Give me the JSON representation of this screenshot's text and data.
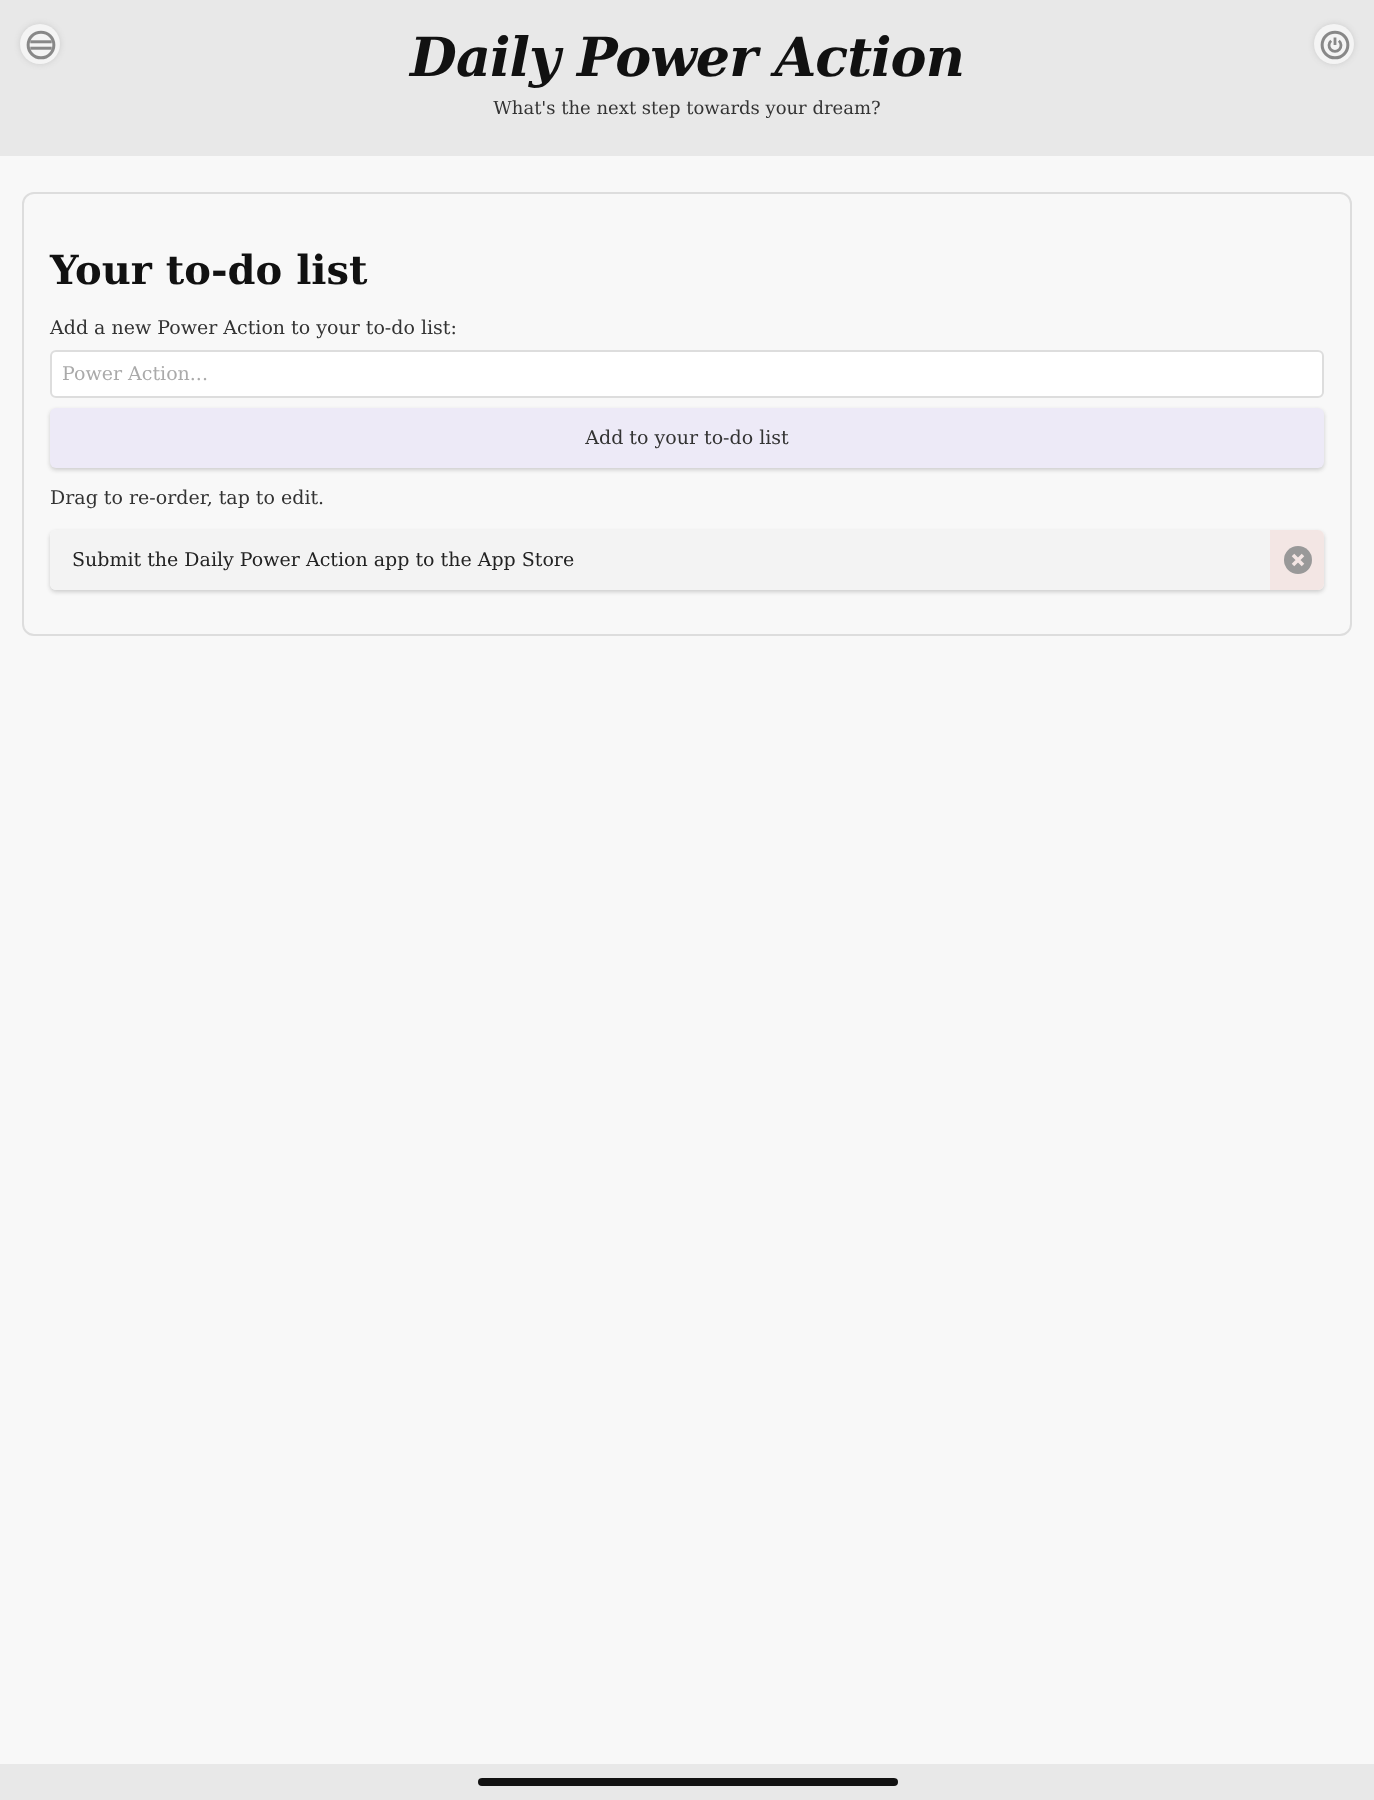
{
  "header": {
    "title": "Daily Power Action",
    "subtitle": "What's the next step towards your dream?"
  },
  "card": {
    "heading": "Your to-do list",
    "prompt": "Add a new Power Action to your to-do list:",
    "input": {
      "placeholder": "Power Action..."
    },
    "add_button": "Add to your to-do list",
    "hint": "Drag to re-order, tap to edit.",
    "items": [
      {
        "text": "Submit the Daily Power Action app to the App Store"
      }
    ]
  }
}
